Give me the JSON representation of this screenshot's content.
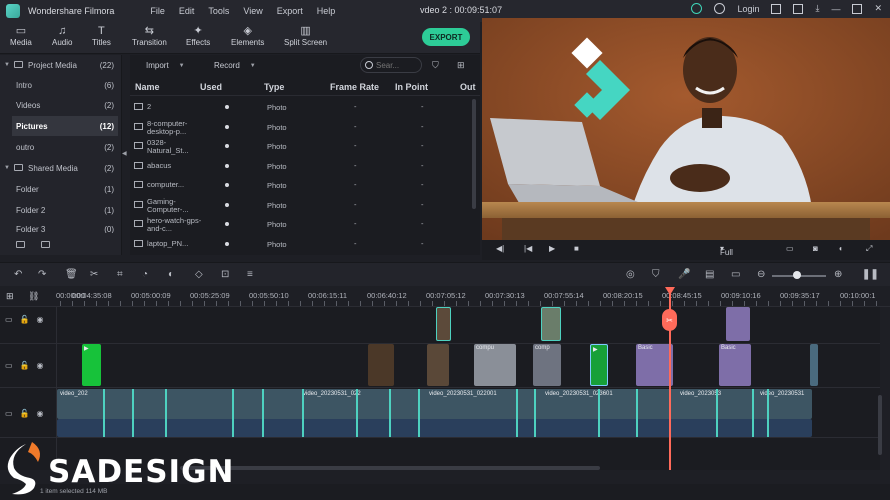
{
  "app": {
    "name": "Wondershare Filmora",
    "project_title": "vdeo 2 : 00:09:51:07",
    "login_label": "Login"
  },
  "menu": [
    "File",
    "Edit",
    "Tools",
    "View",
    "Export",
    "Help"
  ],
  "toolbar": {
    "tabs": [
      {
        "label": "Media",
        "icon": "media-folder-icon"
      },
      {
        "label": "Audio",
        "icon": "music-note-icon"
      },
      {
        "label": "Titles",
        "icon": "text-t-icon"
      },
      {
        "label": "Transition",
        "icon": "transition-icon"
      },
      {
        "label": "Effects",
        "icon": "effects-sparkle-icon"
      },
      {
        "label": "Elements",
        "icon": "elements-shapes-icon"
      },
      {
        "label": "Split Screen",
        "icon": "split-screen-icon"
      }
    ],
    "export_label": "EXPORT"
  },
  "sidebar": {
    "items": [
      {
        "label": "Project Media",
        "count": "(22)",
        "kind": "head"
      },
      {
        "label": "Intro",
        "count": "(6)"
      },
      {
        "label": "Videos",
        "count": "(2)"
      },
      {
        "label": "Pictures",
        "count": "(12)",
        "selected": true
      },
      {
        "label": "outro",
        "count": "(2)"
      },
      {
        "label": "Shared Media",
        "count": "(2)",
        "kind": "head"
      },
      {
        "label": "Folder",
        "count": "(1)"
      },
      {
        "label": "Folder 2",
        "count": "(1)"
      },
      {
        "label": "Folder 3",
        "count": "(0)"
      }
    ]
  },
  "media": {
    "import_label": "Import",
    "record_label": "Record",
    "search_placeholder": "Sear...",
    "columns": [
      "Name",
      "Used",
      "Type",
      "Frame Rate",
      "In Point",
      "Out"
    ],
    "rows": [
      {
        "name": "2",
        "type": "Photo",
        "frame_rate": "-",
        "in_point": "-"
      },
      {
        "name": "8-computer-desktop-p...",
        "type": "Photo",
        "frame_rate": "-",
        "in_point": "-"
      },
      {
        "name": "0328-Natural_St...",
        "type": "Photo",
        "frame_rate": "-",
        "in_point": "-"
      },
      {
        "name": "abacus",
        "type": "Photo",
        "frame_rate": "-",
        "in_point": "-"
      },
      {
        "name": "computer...",
        "type": "Photo",
        "frame_rate": "-",
        "in_point": "-"
      },
      {
        "name": "Gaming-Computer-...",
        "type": "Photo",
        "frame_rate": "-",
        "in_point": "-"
      },
      {
        "name": "hero-watch-gps-and-c...",
        "type": "Photo",
        "frame_rate": "-",
        "in_point": "-"
      },
      {
        "name": "laptop_PN...",
        "type": "Photo",
        "frame_rate": "-",
        "in_point": "-"
      }
    ]
  },
  "preview": {
    "quality_label": "Full"
  },
  "ruler": {
    "timecodes": [
      "00:00:00",
      "00:04:35:08",
      "00:05:00:09",
      "00:05:25:09",
      "00:05:50:10",
      "00:06:15:11",
      "00:06:40:12",
      "00:07:05:12",
      "00:07:30:13",
      "00:07:55:14",
      "00:08:20:15",
      "00:08:45:15",
      "00:09:10:16",
      "00:09:35:17",
      "00:10:00:1"
    ]
  },
  "timeline": {
    "title_clip_label": "Basic",
    "video_clip_labels": [
      "video_202",
      "video_20230531_022",
      "video_20230531_022001",
      "video_20230531_023601",
      "video_2023053",
      "video_20230531"
    ],
    "photo_clip_labels": [
      "compu",
      "comp"
    ]
  },
  "status": {
    "text": "1 item selected  114 MB"
  },
  "watermark": {
    "text": "SADESIGN"
  },
  "colors": {
    "accent": "#2dcc97",
    "playhead": "#ff6a5a",
    "title_clip": "#7e6ea8",
    "green_clip": "#17c23a",
    "video_clip": "#4a6a7e"
  }
}
